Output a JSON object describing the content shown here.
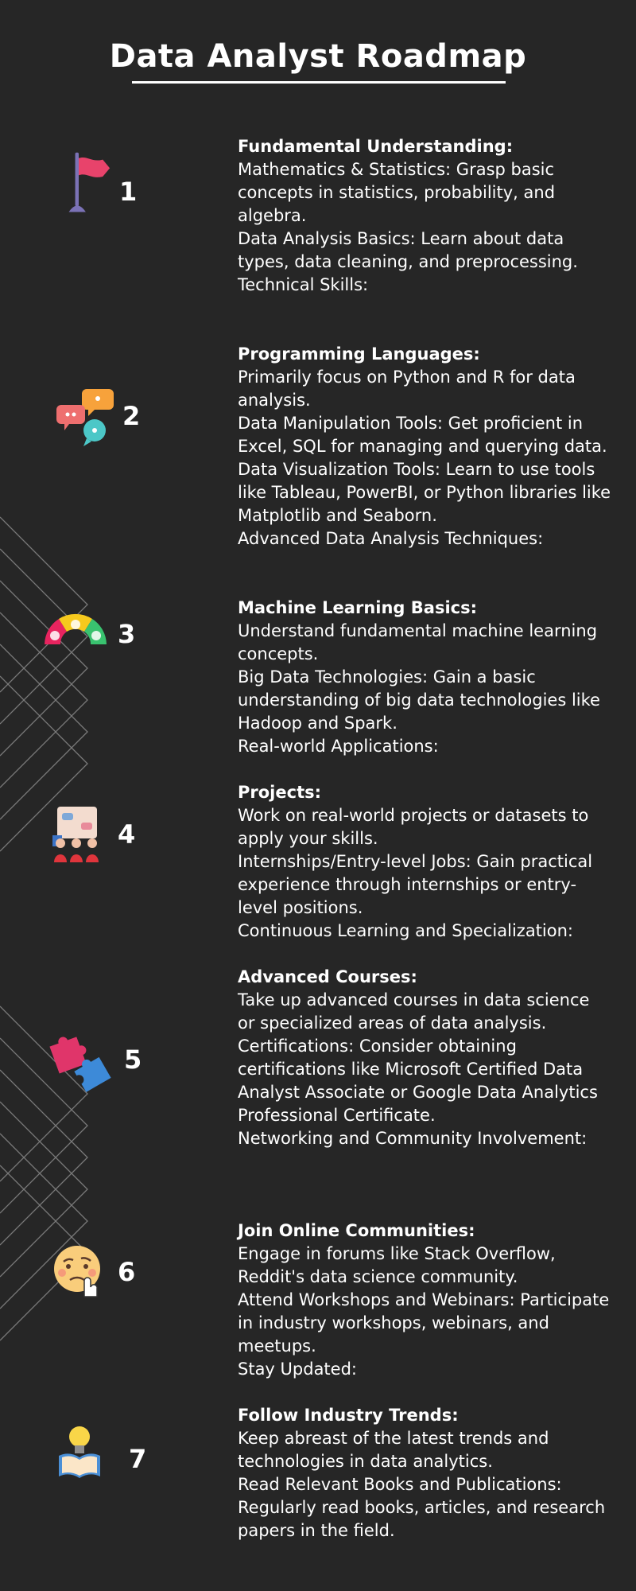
{
  "page": {
    "title": "Data Analyst Roadmap"
  },
  "steps": [
    {
      "number": "1",
      "icon": "flag-icon",
      "heading": "Fundamental Understanding:",
      "lines": [
        "Mathematics & Statistics: Grasp basic concepts in statistics, probability, and algebra.",
        "Data Analysis Basics: Learn about data types, data cleaning, and preprocessing.",
        "Technical Skills:"
      ]
    },
    {
      "number": "2",
      "icon": "chat-bubbles-icon",
      "heading": "Programming Languages:",
      "lines": [
        "Primarily focus on Python and R for data analysis.",
        "Data Manipulation Tools: Get proficient in Excel, SQL for managing and querying data.",
        "Data Visualization Tools: Learn to use tools like Tableau, PowerBI, or Python libraries like Matplotlib and Seaborn.",
        "Advanced Data Analysis Techniques:"
      ]
    },
    {
      "number": "3",
      "icon": "mood-gauge-icon",
      "heading": "Machine Learning Basics:",
      "lines": [
        "Understand fundamental machine learning concepts.",
        "Big Data Technologies: Gain a basic understanding of big data technologies like Hadoop and Spark.",
        "Real-world Applications:"
      ]
    },
    {
      "number": "4",
      "icon": "team-discussion-icon",
      "heading": "Projects:",
      "lines": [
        "Work on real-world projects or datasets to apply your skills.",
        "Internships/Entry-level Jobs: Gain practical experience through internships or entry-level positions.",
        "Continuous Learning and Specialization:"
      ]
    },
    {
      "number": "5",
      "icon": "puzzle-pieces-icon",
      "heading": "Advanced Courses:",
      "lines": [
        "Take up advanced courses in data science or specialized areas of data analysis.",
        "Certifications: Consider obtaining certifications like Microsoft Certified Data Analyst Associate or Google Data Analytics Professional Certificate.",
        "Networking and Community Involvement:"
      ]
    },
    {
      "number": "6",
      "icon": "thinking-face-icon",
      "heading": "Join Online Communities:",
      "lines": [
        "Engage in forums like Stack Overflow, Reddit's data science community.",
        "Attend Workshops and Webinars: Participate in industry workshops, webinars, and meetups.",
        "Stay Updated:"
      ]
    },
    {
      "number": "7",
      "icon": "lightbulb-book-icon",
      "heading": "Follow Industry Trends:",
      "lines": [
        "Keep abreast of the latest trends and technologies in data analytics.",
        "Read Relevant Books and Publications: Regularly read books, articles, and research papers in the field."
      ]
    }
  ]
}
